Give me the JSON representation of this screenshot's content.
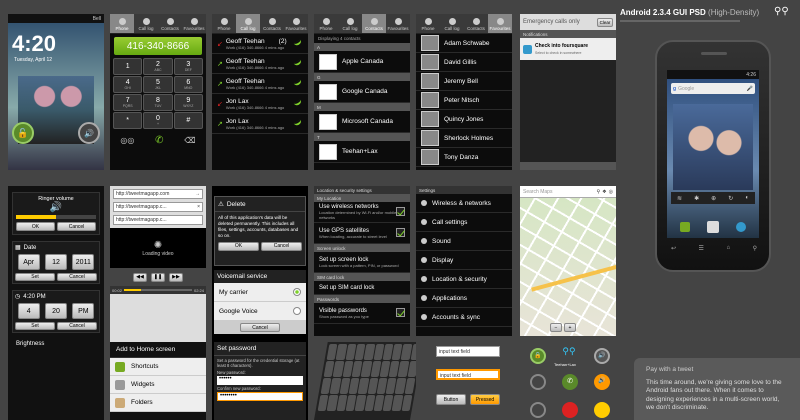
{
  "lock": {
    "time": "4:20",
    "date": "Tuesday, April 12",
    "carrier": "Bell"
  },
  "tabs": [
    "Phone",
    "Call log",
    "Contacts",
    "Favourites"
  ],
  "dialer": {
    "number": "416-340-8666",
    "keys": [
      [
        "1",
        ""
      ],
      [
        "2",
        "ABC"
      ],
      [
        "3",
        "DEF"
      ],
      [
        "4",
        "GHI"
      ],
      [
        "5",
        "JKL"
      ],
      [
        "6",
        "MNO"
      ],
      [
        "7",
        "PQRS"
      ],
      [
        "8",
        "TUV"
      ],
      [
        "9",
        "WXYZ"
      ],
      [
        "*",
        ""
      ],
      [
        "0",
        "+"
      ],
      [
        "#",
        ""
      ]
    ]
  },
  "calllog": [
    {
      "name": "Geoff Teehan",
      "count": "(2)",
      "detail": "Work (416) 340-8666 4 mins ago",
      "type": "missed"
    },
    {
      "name": "Geoff Teehan",
      "count": "",
      "detail": "Work (416) 340-8666 4 mins ago",
      "type": "out"
    },
    {
      "name": "Geoff Teehan",
      "count": "",
      "detail": "Work (416) 340-8666 4 mins ago",
      "type": "out"
    },
    {
      "name": "Jon Lax",
      "count": "",
      "detail": "Work (416) 340-8666 4 mins ago",
      "type": "missed"
    },
    {
      "name": "Jon Lax",
      "count": "",
      "detail": "Work (416) 340-8666 4 mins ago",
      "type": "out"
    }
  ],
  "contacts": {
    "header": "Displaying 4 contacts",
    "sections": [
      {
        "letter": "A",
        "name": "Apple Canada"
      },
      {
        "letter": "G",
        "name": "Google Canada"
      },
      {
        "letter": "M",
        "name": "Microsoft Canada"
      },
      {
        "letter": "T",
        "name": "Teehan+Lax"
      }
    ]
  },
  "favourites": [
    "Adam Schwabe",
    "David Gillis",
    "Jeremy Bell",
    "Peter Nitsch",
    "Quincy Jones",
    "Sherlock Holmes",
    "Tony Danza"
  ],
  "notif": {
    "status": "Emergency calls only",
    "clear": "Clear",
    "header": "Notifications",
    "item": "Check into foursquare",
    "sub": "Select to check in somewhere"
  },
  "header": {
    "title": "Android 2.3.4 GUI PSD",
    "subtitle": "(High-Density)"
  },
  "ringer": {
    "title": "Ringer volume",
    "ok": "OK",
    "cancel": "Cancel"
  },
  "date": {
    "title": "Date",
    "values": [
      "Apr",
      "12",
      "2011"
    ],
    "set": "Set",
    "cancel": "Cancel"
  },
  "time": {
    "title": "4:20 PM",
    "values": [
      "4",
      "20",
      "PM"
    ],
    "set": "Set",
    "cancel": "Cancel"
  },
  "brightness": "Brightness",
  "browser": {
    "url": "http://tweetmagapp.com",
    "url2": "http://tweetmagapp.c...",
    "loading": "Loading video",
    "time_left": "00:02",
    "time_right": "02:24"
  },
  "home": {
    "title": "Add to Home screen",
    "items": [
      "Shortcuts",
      "Widgets",
      "Folders"
    ]
  },
  "delete": {
    "title": "Delete",
    "body": "All of this application's data will be deleted permanently. This includes all files, settings, accounts, databases and so on.",
    "ok": "OK",
    "cancel": "Cancel"
  },
  "voicemail": {
    "title": "Voicemail service",
    "options": [
      "My carrier",
      "Google Voice"
    ],
    "cancel": "Cancel"
  },
  "password": {
    "title": "Set password",
    "body": "Set a password for the credential storage (at least 8 characters).",
    "new_label": "New password:",
    "new_value": "••••••",
    "confirm_label": "Confirm new password:",
    "confirm_value": "••••••••",
    "ok": "OK",
    "cancel": "Cancel"
  },
  "security": {
    "title": "Location & security settings",
    "sections": [
      {
        "header": "My Location",
        "items": [
          {
            "t": "Use wireless networks",
            "s": "Location determined by Wi-Fi and/or mobile networks",
            "c": true
          },
          {
            "t": "Use GPS satellites",
            "s": "When locating, accurate to street level",
            "c": true
          }
        ]
      },
      {
        "header": "Screen unlock",
        "items": [
          {
            "t": "Set up screen lock",
            "s": "Lock screen with a pattern, PIN, or password",
            "c": false
          }
        ]
      },
      {
        "header": "SIM card lock",
        "items": [
          {
            "t": "Set up SIM card lock",
            "s": "",
            "c": false
          }
        ]
      },
      {
        "header": "Passwords",
        "items": [
          {
            "t": "Visible passwords",
            "s": "Show password as you type",
            "c": true
          }
        ]
      }
    ]
  },
  "settings": {
    "title": "Settings",
    "items": [
      "Wireless & networks",
      "Call settings",
      "Sound",
      "Display",
      "Location & security",
      "Applications",
      "Accounts & sync"
    ]
  },
  "maps": {
    "search": "Search Maps"
  },
  "fields": {
    "input1": "input text field",
    "input2": "input text field",
    "button": "Button",
    "pressed": "Pressed"
  },
  "phone": {
    "time": "4:26",
    "search": "Google"
  },
  "tweet": {
    "title": "Pay with a tweet",
    "body": "This time around, we're giving some love to the Android fans out there. When it comes to designing experiences in a multi-screen world, we don't discriminate."
  },
  "teehan": "Teehan+Lax"
}
